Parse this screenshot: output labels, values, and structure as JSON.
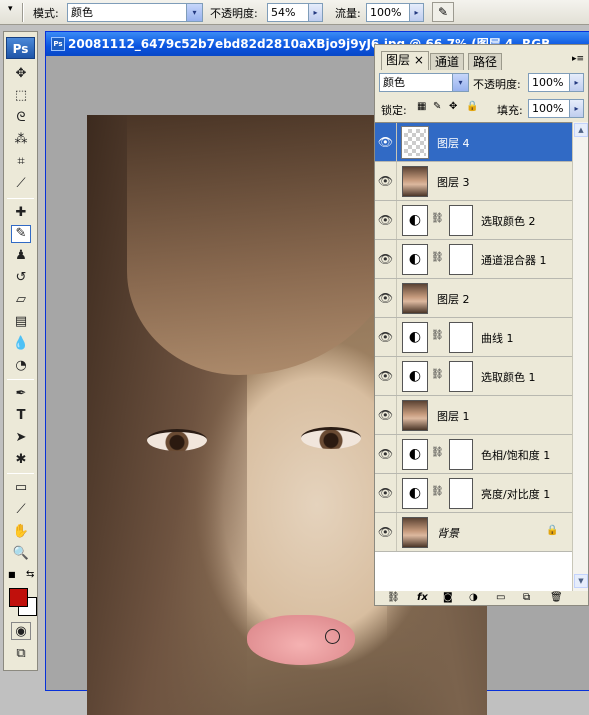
{
  "options_bar": {
    "mode_label": "模式:",
    "mode_value": "颜色",
    "opacity_label": "不透明度:",
    "opacity_value": "54%",
    "flow_label": "流量:",
    "flow_value": "100%",
    "arrow_glyph": "▸",
    "dropdown_glyph": "▾"
  },
  "toolbox": {
    "logo": "Ps",
    "foreground_color": "#c0100c",
    "background_color": "#ffffff"
  },
  "document": {
    "title": "20081112_6479c52b7ebd82d2810aXBjo9j9yJ6.jpg @ 66.7% (图层 4, RGB"
  },
  "layers_panel": {
    "tabs": [
      "图层",
      "通道",
      "路径"
    ],
    "tab_close": "×",
    "blend_mode": "颜色",
    "opacity_label": "不透明度:",
    "opacity_value": "100%",
    "lock_label": "锁定:",
    "fill_label": "填充:",
    "fill_value": "100%",
    "layers": [
      {
        "name": "图层 4",
        "kind": "transparent",
        "selected": true
      },
      {
        "name": "图层 3",
        "kind": "portrait"
      },
      {
        "name": "选取颜色 2",
        "kind": "adjustment"
      },
      {
        "name": "通道混合器 1",
        "kind": "adjustment"
      },
      {
        "name": "图层 2",
        "kind": "portrait"
      },
      {
        "name": "曲线 1",
        "kind": "adjustment"
      },
      {
        "name": "选取颜色 1",
        "kind": "adjustment"
      },
      {
        "name": "图层 1",
        "kind": "portrait"
      },
      {
        "name": "色相/饱和度 1",
        "kind": "adjustment"
      },
      {
        "name": "亮度/对比度 1",
        "kind": "adjustment"
      },
      {
        "name": "背景",
        "kind": "portrait",
        "locked": true
      }
    ]
  }
}
